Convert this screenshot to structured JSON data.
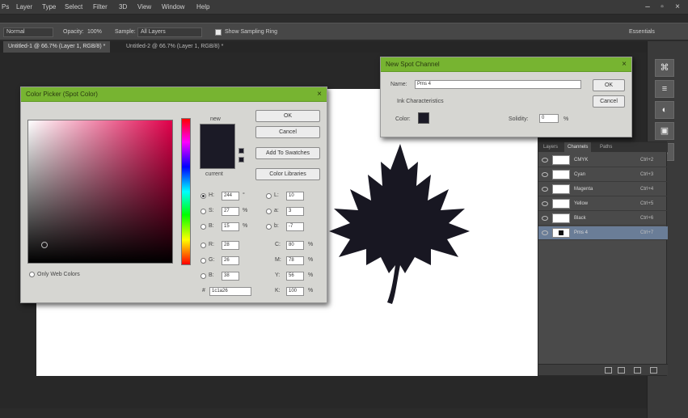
{
  "app": {
    "menu": [
      "Ps",
      "Layer",
      "Type",
      "Select",
      "Filter",
      "3D",
      "View",
      "Window",
      "Help"
    ],
    "workspace_label": "Essentials",
    "window_controls": [
      "–",
      "▫",
      "×"
    ]
  },
  "optionsbar": {
    "style_label": "Normal",
    "opacity_label": "Opacity:",
    "opacity_value": "100%",
    "sample_label": "Sample:",
    "sample_value": "All Layers",
    "checkbox_label": "Show Sampling Ring"
  },
  "tabs": [
    {
      "label": "Untitled-1 @ 66.7% (Layer 1, RGB/8) *",
      "active": true
    },
    {
      "label": "Untitled-2 @ 66.7% (Layer 1, RGB/8) *",
      "active": false
    }
  ],
  "channels_panel": {
    "tabs": [
      "Layers",
      "Channels",
      "Paths"
    ],
    "active_tab": "Channels",
    "rows": [
      {
        "name": "CMYK",
        "key": "Ctrl+2",
        "selected": false
      },
      {
        "name": "Cyan",
        "key": "Ctrl+3",
        "selected": false
      },
      {
        "name": "Magenta",
        "key": "Ctrl+4",
        "selected": false
      },
      {
        "name": "Yellow",
        "key": "Ctrl+5",
        "selected": false
      },
      {
        "name": "Black",
        "key": "Ctrl+6",
        "selected": false
      },
      {
        "name": "Pms 4",
        "key": "Ctrl+7",
        "selected": true
      }
    ]
  },
  "color_picker": {
    "title": "Color Picker (Spot Color)",
    "ok": "OK",
    "cancel": "Cancel",
    "add_to_swatches": "Add To Swatches",
    "color_libraries": "Color Libraries",
    "new_label": "new",
    "current_label": "current",
    "only_web_colors": "Only Web Colors",
    "hsb": [
      {
        "label": "H:",
        "value": "244",
        "unit": "°"
      },
      {
        "label": "S:",
        "value": "27",
        "unit": "%"
      },
      {
        "label": "B:",
        "value": "15",
        "unit": "%"
      }
    ],
    "rgb": [
      {
        "label": "R:",
        "value": "28"
      },
      {
        "label": "G:",
        "value": "26"
      },
      {
        "label": "B:",
        "value": "38"
      }
    ],
    "lab": [
      {
        "label": "L:",
        "value": "10"
      },
      {
        "label": "a:",
        "value": "3"
      },
      {
        "label": "b:",
        "value": "-7"
      }
    ],
    "cmyk": [
      {
        "label": "C:",
        "value": "80",
        "unit": "%"
      },
      {
        "label": "M:",
        "value": "78",
        "unit": "%"
      },
      {
        "label": "Y:",
        "value": "56",
        "unit": "%"
      },
      {
        "label": "K:",
        "value": "100",
        "unit": "%"
      }
    ],
    "hex_label": "#",
    "hex_value": "1c1a26",
    "swatch_color": "#1b1a26"
  },
  "spot_channel": {
    "title": "New Spot Channel",
    "name_label": "Name:",
    "name_value": "Pms 4",
    "ok": "OK",
    "cancel": "Cancel",
    "ink_label": "Ink Characteristics",
    "color_label": "Color:",
    "solidity_label": "Solidity:",
    "solidity_value": "0",
    "solidity_unit": "%",
    "color_value": "#1b1a26"
  },
  "colors": {
    "dialog_title_bar": "#77b431",
    "leaf_fill": "#181722"
  }
}
